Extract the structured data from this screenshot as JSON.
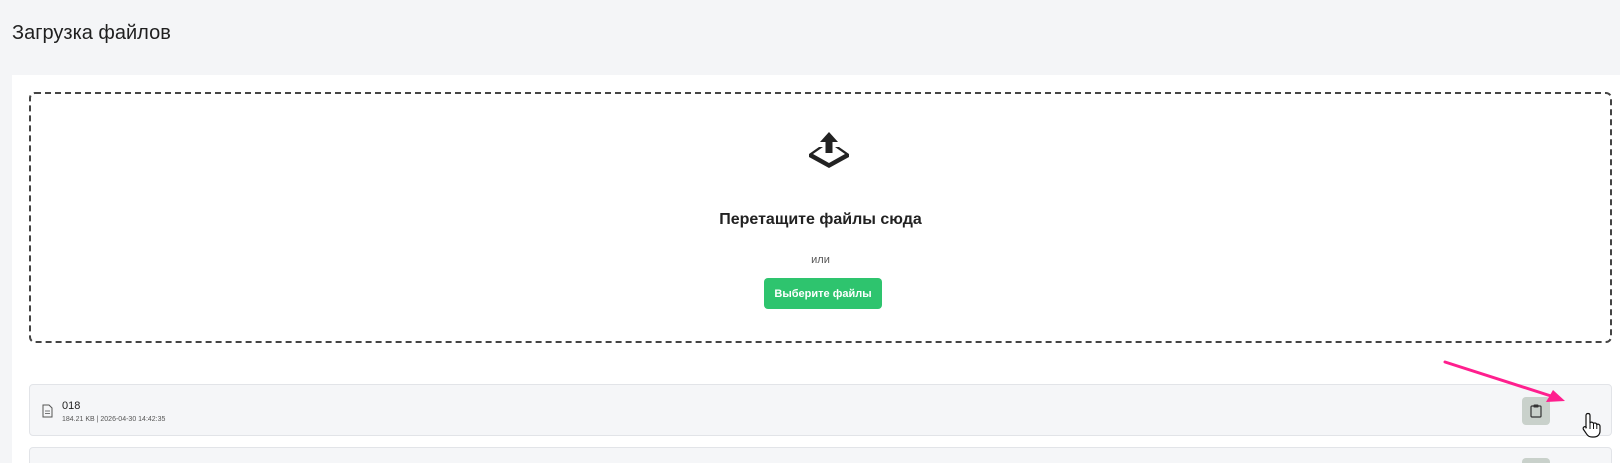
{
  "page": {
    "title": "Загрузка файлов"
  },
  "dropzone": {
    "icon": "upload-tray-icon",
    "title": "Перетащите файлы сюда",
    "or_text": "или",
    "button_label": "Выберите файлы"
  },
  "files": [
    {
      "name": "018",
      "meta": "184.21 KB | 2026-04-30 14:42:35",
      "icon": "file-icon",
      "action_icon": "clipboard-icon"
    }
  ],
  "colors": {
    "primary_button": "#2ec46e",
    "annotation_arrow": "#ff1f8e",
    "copy_button_bg": "#c9d1cb"
  }
}
